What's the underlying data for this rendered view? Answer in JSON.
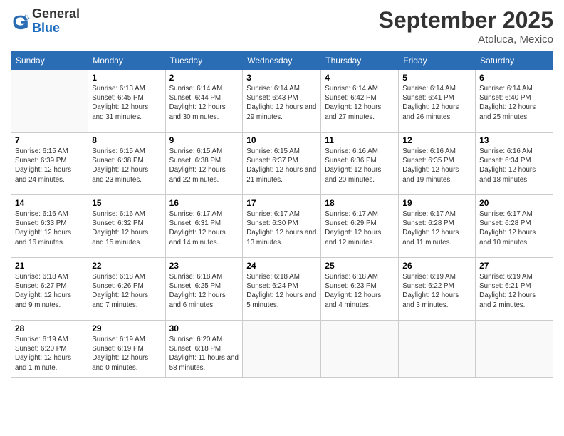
{
  "header": {
    "logo_line1": "General",
    "logo_line2": "Blue",
    "month_title": "September 2025",
    "location": "Atoluca, Mexico"
  },
  "days_of_week": [
    "Sunday",
    "Monday",
    "Tuesday",
    "Wednesday",
    "Thursday",
    "Friday",
    "Saturday"
  ],
  "weeks": [
    [
      {
        "day": "",
        "info": ""
      },
      {
        "day": "1",
        "info": "Sunrise: 6:13 AM\nSunset: 6:45 PM\nDaylight: 12 hours\nand 31 minutes."
      },
      {
        "day": "2",
        "info": "Sunrise: 6:14 AM\nSunset: 6:44 PM\nDaylight: 12 hours\nand 30 minutes."
      },
      {
        "day": "3",
        "info": "Sunrise: 6:14 AM\nSunset: 6:43 PM\nDaylight: 12 hours\nand 29 minutes."
      },
      {
        "day": "4",
        "info": "Sunrise: 6:14 AM\nSunset: 6:42 PM\nDaylight: 12 hours\nand 27 minutes."
      },
      {
        "day": "5",
        "info": "Sunrise: 6:14 AM\nSunset: 6:41 PM\nDaylight: 12 hours\nand 26 minutes."
      },
      {
        "day": "6",
        "info": "Sunrise: 6:14 AM\nSunset: 6:40 PM\nDaylight: 12 hours\nand 25 minutes."
      }
    ],
    [
      {
        "day": "7",
        "info": "Sunrise: 6:15 AM\nSunset: 6:39 PM\nDaylight: 12 hours\nand 24 minutes."
      },
      {
        "day": "8",
        "info": "Sunrise: 6:15 AM\nSunset: 6:38 PM\nDaylight: 12 hours\nand 23 minutes."
      },
      {
        "day": "9",
        "info": "Sunrise: 6:15 AM\nSunset: 6:38 PM\nDaylight: 12 hours\nand 22 minutes."
      },
      {
        "day": "10",
        "info": "Sunrise: 6:15 AM\nSunset: 6:37 PM\nDaylight: 12 hours\nand 21 minutes."
      },
      {
        "day": "11",
        "info": "Sunrise: 6:16 AM\nSunset: 6:36 PM\nDaylight: 12 hours\nand 20 minutes."
      },
      {
        "day": "12",
        "info": "Sunrise: 6:16 AM\nSunset: 6:35 PM\nDaylight: 12 hours\nand 19 minutes."
      },
      {
        "day": "13",
        "info": "Sunrise: 6:16 AM\nSunset: 6:34 PM\nDaylight: 12 hours\nand 18 minutes."
      }
    ],
    [
      {
        "day": "14",
        "info": "Sunrise: 6:16 AM\nSunset: 6:33 PM\nDaylight: 12 hours\nand 16 minutes."
      },
      {
        "day": "15",
        "info": "Sunrise: 6:16 AM\nSunset: 6:32 PM\nDaylight: 12 hours\nand 15 minutes."
      },
      {
        "day": "16",
        "info": "Sunrise: 6:17 AM\nSunset: 6:31 PM\nDaylight: 12 hours\nand 14 minutes."
      },
      {
        "day": "17",
        "info": "Sunrise: 6:17 AM\nSunset: 6:30 PM\nDaylight: 12 hours\nand 13 minutes."
      },
      {
        "day": "18",
        "info": "Sunrise: 6:17 AM\nSunset: 6:29 PM\nDaylight: 12 hours\nand 12 minutes."
      },
      {
        "day": "19",
        "info": "Sunrise: 6:17 AM\nSunset: 6:28 PM\nDaylight: 12 hours\nand 11 minutes."
      },
      {
        "day": "20",
        "info": "Sunrise: 6:17 AM\nSunset: 6:28 PM\nDaylight: 12 hours\nand 10 minutes."
      }
    ],
    [
      {
        "day": "21",
        "info": "Sunrise: 6:18 AM\nSunset: 6:27 PM\nDaylight: 12 hours\nand 9 minutes."
      },
      {
        "day": "22",
        "info": "Sunrise: 6:18 AM\nSunset: 6:26 PM\nDaylight: 12 hours\nand 7 minutes."
      },
      {
        "day": "23",
        "info": "Sunrise: 6:18 AM\nSunset: 6:25 PM\nDaylight: 12 hours\nand 6 minutes."
      },
      {
        "day": "24",
        "info": "Sunrise: 6:18 AM\nSunset: 6:24 PM\nDaylight: 12 hours\nand 5 minutes."
      },
      {
        "day": "25",
        "info": "Sunrise: 6:18 AM\nSunset: 6:23 PM\nDaylight: 12 hours\nand 4 minutes."
      },
      {
        "day": "26",
        "info": "Sunrise: 6:19 AM\nSunset: 6:22 PM\nDaylight: 12 hours\nand 3 minutes."
      },
      {
        "day": "27",
        "info": "Sunrise: 6:19 AM\nSunset: 6:21 PM\nDaylight: 12 hours\nand 2 minutes."
      }
    ],
    [
      {
        "day": "28",
        "info": "Sunrise: 6:19 AM\nSunset: 6:20 PM\nDaylight: 12 hours\nand 1 minute."
      },
      {
        "day": "29",
        "info": "Sunrise: 6:19 AM\nSunset: 6:19 PM\nDaylight: 12 hours\nand 0 minutes."
      },
      {
        "day": "30",
        "info": "Sunrise: 6:20 AM\nSunset: 6:18 PM\nDaylight: 11 hours\nand 58 minutes."
      },
      {
        "day": "",
        "info": ""
      },
      {
        "day": "",
        "info": ""
      },
      {
        "day": "",
        "info": ""
      },
      {
        "day": "",
        "info": ""
      }
    ]
  ]
}
